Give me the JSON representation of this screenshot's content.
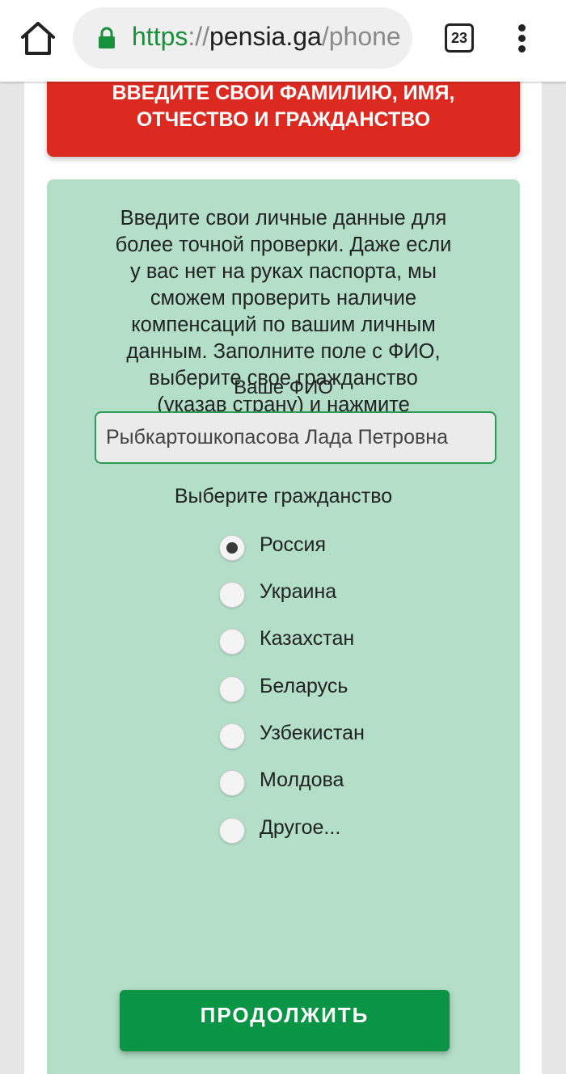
{
  "browser": {
    "url_scheme": "https",
    "url_separator": "://",
    "url_host": "pensia.ga",
    "url_path": "/phone",
    "tab_count": "23",
    "icons": {
      "home": "home-icon",
      "lock": "lock-icon",
      "menu": "more-vert-icon"
    }
  },
  "banner": {
    "line1": "ВВЕДИТЕ СВОИ ФАМИЛИЮ, ИМЯ,",
    "line2": "ОТЧЕСТВО И ГРАЖДАНСТВО"
  },
  "form": {
    "intro_lines": [
      "Введите свои личные данные для",
      "более точной проверки. Даже если",
      "у вас нет на руках паспорта, мы",
      "сможем проверить наличие",
      "компенсаций по вашим личным",
      "данным. Заполните поле с ФИО,",
      "выберите свое гражданство",
      "(указав страну) и нажмите"
    ],
    "fio_label": "Ваше ФИО",
    "fio_value": "Рыбкартошкопасова Лада Петровна",
    "citizenship_label": "Выберите гражданство",
    "citizenship_options": [
      {
        "label": "Россия",
        "checked": true
      },
      {
        "label": "Украина",
        "checked": false
      },
      {
        "label": "Казахстан",
        "checked": false
      },
      {
        "label": "Беларусь",
        "checked": false
      },
      {
        "label": "Узбекистан",
        "checked": false
      },
      {
        "label": "Молдова",
        "checked": false
      },
      {
        "label": "Другое...",
        "checked": false
      }
    ],
    "continue_label": "ПРОДОЛЖИТЬ"
  },
  "colors": {
    "banner_red": "#dc2a20",
    "form_green": "#b3dfc8",
    "button_green": "#0a9445",
    "url_green": "#1a8f3c"
  }
}
